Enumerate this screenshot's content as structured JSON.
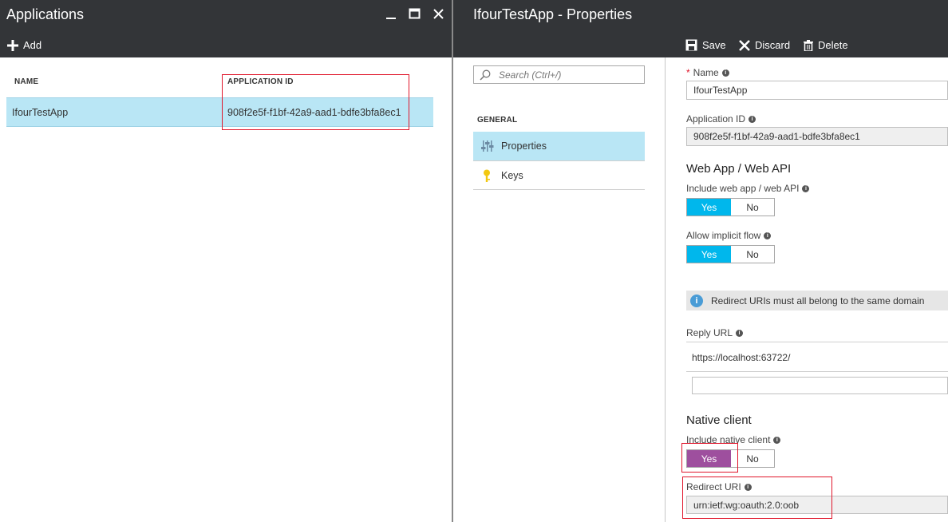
{
  "left_blade": {
    "title": "Applications",
    "add_label": "Add",
    "table": {
      "col_name": "NAME",
      "col_app_id": "APPLICATION ID",
      "rows": [
        {
          "name": "IfourTestApp",
          "app_id": "908f2e5f-f1bf-42a9-aad1-bdfe3bfa8ec1"
        }
      ]
    }
  },
  "right_blade": {
    "title": "IfourTestApp - Properties",
    "toolbar": {
      "save": "Save",
      "discard": "Discard",
      "delete": "Delete"
    },
    "nav": {
      "search_placeholder": "Search (Ctrl+/)",
      "section_general": "GENERAL",
      "items": [
        "Properties",
        "Keys"
      ]
    },
    "form": {
      "required_mark": "*",
      "name_label": "Name",
      "name_value": "IfourTestApp",
      "app_id_label": "Application ID",
      "app_id_value": "908f2e5f-f1bf-42a9-aad1-bdfe3bfa8ec1",
      "web_section": "Web App / Web API",
      "include_web_label": "Include web app / web API",
      "implicit_label": "Allow implicit flow",
      "yes": "Yes",
      "no": "No",
      "info_banner": "Redirect URIs must all belong to the same domain",
      "reply_url_label": "Reply URL",
      "reply_url_value": "https://localhost:63722/",
      "reply_url_empty": "",
      "native_section": "Native client",
      "include_native_label": "Include native client",
      "redirect_uri_label": "Redirect URI",
      "redirect_uri_value": "urn:ietf:wg:oauth:2.0:oob"
    }
  },
  "colors": {
    "header": "#333538",
    "selection": "#b9e6f5",
    "toggle_on": "#00b7ec",
    "toggle_native": "#9e4f9e",
    "highlight": "#e0162b"
  }
}
